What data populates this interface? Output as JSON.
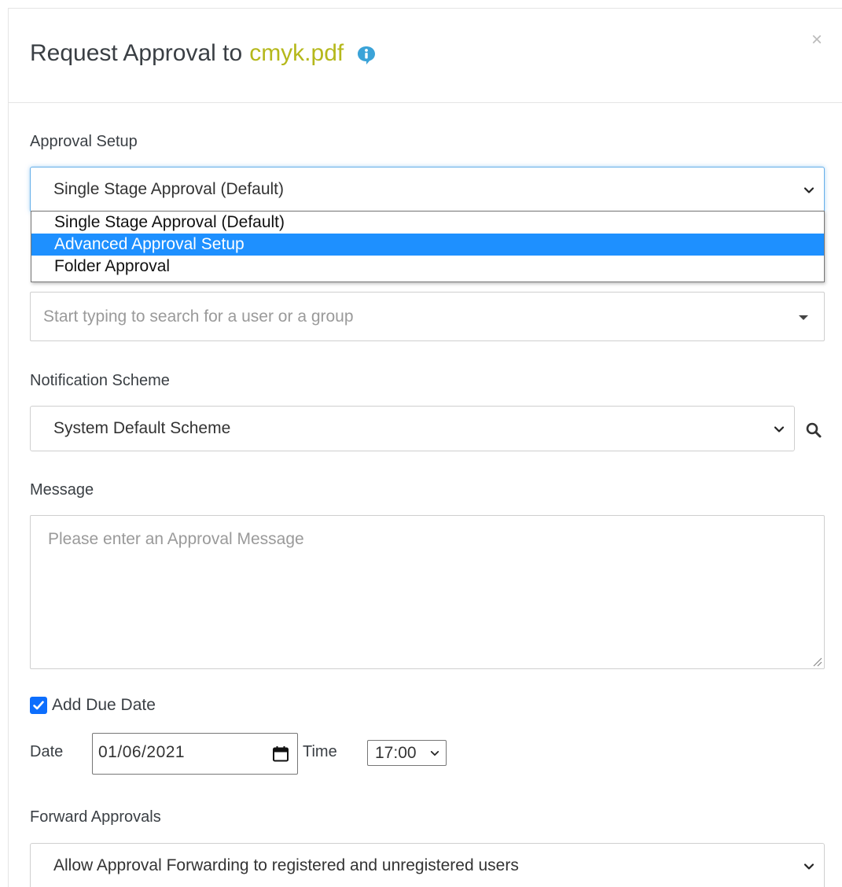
{
  "dialog": {
    "title_prefix": "Request Approval to",
    "file_name": "cmyk.pdf",
    "close_glyph": "×"
  },
  "approval_setup": {
    "label": "Approval Setup",
    "selected": "Single Stage Approval (Default)",
    "options": [
      "Single Stage Approval (Default)",
      "Advanced Approval Setup",
      "Folder Approval"
    ],
    "highlighted_index": 1
  },
  "user_search": {
    "placeholder": "Start typing to search for a user or a group"
  },
  "notification": {
    "label": "Notification Scheme",
    "selected": "System Default Scheme"
  },
  "message": {
    "label": "Message",
    "placeholder": "Please enter an Approval Message"
  },
  "due_date": {
    "checkbox_label": "Add Due Date",
    "checked": true,
    "date_label": "Date",
    "date_value": "01/06/2021",
    "time_label": "Time",
    "time_value": "17:00"
  },
  "forward": {
    "label": "Forward Approvals",
    "selected": "Allow Approval Forwarding to registered and unregistered users"
  },
  "colors": {
    "file_name": "#b5b81b",
    "info_icon": "#3ba3d8",
    "highlight": "#1e90ff",
    "checkbox": "#0d6efd"
  },
  "icons": [
    "info-icon",
    "close-icon",
    "chevron-down-icon",
    "caret-down-icon",
    "search-icon",
    "calendar-icon",
    "check-icon",
    "resize-handle-icon"
  ]
}
